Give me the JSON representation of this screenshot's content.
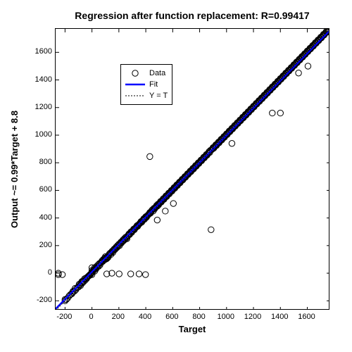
{
  "chart_data": {
    "type": "scatter",
    "title": "Regression after function replacement: R=0.99417",
    "xlabel": "Target",
    "ylabel": "Output ~= 0.99*Target + 8.8",
    "xlim": [
      -270,
      1770
    ],
    "ylim": [
      -270,
      1770
    ],
    "x_ticks": [
      -200,
      0,
      200,
      400,
      600,
      800,
      1000,
      1200,
      1400,
      1600
    ],
    "y_ticks": [
      -200,
      0,
      200,
      400,
      600,
      800,
      1000,
      1200,
      1400,
      1600
    ],
    "fit": {
      "slope": 0.99,
      "intercept": 8.8,
      "R": 0.99417,
      "color": "#0000ff"
    },
    "reference": {
      "label": "Y = T",
      "slope": 1,
      "intercept": 0
    },
    "legend": {
      "entries": [
        {
          "key": "data",
          "label": "Data"
        },
        {
          "key": "fit",
          "label": "Fit"
        },
        {
          "key": "yeq",
          "label": "Y = T"
        }
      ]
    },
    "data_points": [
      [
        -250,
        -10
      ],
      [
        -250,
        0
      ],
      [
        -220,
        -10
      ],
      [
        -200,
        -200
      ],
      [
        -200,
        -190
      ],
      [
        -190,
        -190
      ],
      [
        -180,
        -180
      ],
      [
        -170,
        -165
      ],
      [
        -160,
        -155
      ],
      [
        -150,
        -150
      ],
      [
        -145,
        -140
      ],
      [
        -140,
        -130
      ],
      [
        -130,
        -130
      ],
      [
        -125,
        -110
      ],
      [
        -120,
        -120
      ],
      [
        -110,
        -105
      ],
      [
        -100,
        -100
      ],
      [
        -95,
        -80
      ],
      [
        -90,
        -85
      ],
      [
        -85,
        -90
      ],
      [
        -80,
        -70
      ],
      [
        -75,
        -60
      ],
      [
        -70,
        -70
      ],
      [
        -65,
        -55
      ],
      [
        -60,
        -60
      ],
      [
        -55,
        -40
      ],
      [
        -50,
        -50
      ],
      [
        -45,
        -35
      ],
      [
        -40,
        -40
      ],
      [
        -35,
        -30
      ],
      [
        -30,
        -25
      ],
      [
        -25,
        -20
      ],
      [
        -20,
        -18
      ],
      [
        -15,
        -10
      ],
      [
        -10,
        -8
      ],
      [
        -5,
        0
      ],
      [
        0,
        -10
      ],
      [
        0,
        5
      ],
      [
        0,
        20
      ],
      [
        0,
        40
      ],
      [
        5,
        10
      ],
      [
        10,
        20
      ],
      [
        15,
        25
      ],
      [
        20,
        15
      ],
      [
        20,
        40
      ],
      [
        25,
        35
      ],
      [
        30,
        30
      ],
      [
        35,
        50
      ],
      [
        40,
        45
      ],
      [
        45,
        60
      ],
      [
        50,
        50
      ],
      [
        55,
        70
      ],
      [
        60,
        60
      ],
      [
        65,
        75
      ],
      [
        70,
        80
      ],
      [
        75,
        90
      ],
      [
        80,
        85
      ],
      [
        85,
        100
      ],
      [
        90,
        95
      ],
      [
        95,
        110
      ],
      [
        100,
        100
      ],
      [
        100,
        120
      ],
      [
        105,
        110
      ],
      [
        110,
        105
      ],
      [
        110,
        -5
      ],
      [
        115,
        120
      ],
      [
        120,
        115
      ],
      [
        125,
        130
      ],
      [
        130,
        140
      ],
      [
        135,
        145
      ],
      [
        140,
        135
      ],
      [
        145,
        150
      ],
      [
        148,
        0
      ],
      [
        150,
        160
      ],
      [
        155,
        150
      ],
      [
        160,
        165
      ],
      [
        165,
        175
      ],
      [
        170,
        170
      ],
      [
        175,
        180
      ],
      [
        180,
        190
      ],
      [
        185,
        185
      ],
      [
        190,
        200
      ],
      [
        195,
        195
      ],
      [
        200,
        210
      ],
      [
        202,
        -5
      ],
      [
        205,
        200
      ],
      [
        210,
        215
      ],
      [
        215,
        225
      ],
      [
        220,
        220
      ],
      [
        225,
        230
      ],
      [
        230,
        240
      ],
      [
        235,
        235
      ],
      [
        240,
        250
      ],
      [
        245,
        245
      ],
      [
        250,
        260
      ],
      [
        255,
        255
      ],
      [
        260,
        250
      ],
      [
        265,
        270
      ],
      [
        270,
        275
      ],
      [
        275,
        285
      ],
      [
        280,
        280
      ],
      [
        285,
        290
      ],
      [
        288,
        -5
      ],
      [
        290,
        300
      ],
      [
        295,
        295
      ],
      [
        300,
        305
      ],
      [
        305,
        310
      ],
      [
        310,
        320
      ],
      [
        315,
        315
      ],
      [
        320,
        325
      ],
      [
        325,
        330
      ],
      [
        330,
        335
      ],
      [
        335,
        345
      ],
      [
        340,
        340
      ],
      [
        345,
        350
      ],
      [
        350,
        355
      ],
      [
        350,
        -5
      ],
      [
        355,
        360
      ],
      [
        360,
        365
      ],
      [
        365,
        375
      ],
      [
        370,
        370
      ],
      [
        375,
        380
      ],
      [
        380,
        385
      ],
      [
        385,
        395
      ],
      [
        390,
        390
      ],
      [
        395,
        400
      ],
      [
        398,
        -10
      ],
      [
        400,
        410
      ],
      [
        405,
        405
      ],
      [
        410,
        415
      ],
      [
        415,
        420
      ],
      [
        420,
        425
      ],
      [
        425,
        430
      ],
      [
        430,
        845
      ],
      [
        430,
        440
      ],
      [
        435,
        435
      ],
      [
        440,
        445
      ],
      [
        445,
        455
      ],
      [
        450,
        460
      ],
      [
        455,
        450
      ],
      [
        460,
        470
      ],
      [
        465,
        465
      ],
      [
        470,
        475
      ],
      [
        475,
        480
      ],
      [
        480,
        490
      ],
      [
        485,
        385
      ],
      [
        485,
        485
      ],
      [
        490,
        500
      ],
      [
        495,
        495
      ],
      [
        500,
        505
      ],
      [
        505,
        510
      ],
      [
        510,
        520
      ],
      [
        515,
        515
      ],
      [
        520,
        525
      ],
      [
        525,
        530
      ],
      [
        530,
        540
      ],
      [
        535,
        535
      ],
      [
        540,
        545
      ],
      [
        545,
        450
      ],
      [
        545,
        550
      ],
      [
        550,
        560
      ],
      [
        555,
        555
      ],
      [
        560,
        565
      ],
      [
        565,
        570
      ],
      [
        570,
        580
      ],
      [
        575,
        575
      ],
      [
        580,
        585
      ],
      [
        585,
        590
      ],
      [
        590,
        600
      ],
      [
        595,
        595
      ],
      [
        600,
        605
      ],
      [
        605,
        505
      ],
      [
        605,
        610
      ],
      [
        610,
        620
      ],
      [
        615,
        615
      ],
      [
        620,
        625
      ],
      [
        625,
        630
      ],
      [
        630,
        640
      ],
      [
        635,
        635
      ],
      [
        640,
        645
      ],
      [
        645,
        650
      ],
      [
        650,
        660
      ],
      [
        655,
        655
      ],
      [
        660,
        665
      ],
      [
        665,
        670
      ],
      [
        670,
        680
      ],
      [
        675,
        675
      ],
      [
        680,
        685
      ],
      [
        685,
        690
      ],
      [
        690,
        700
      ],
      [
        695,
        695
      ],
      [
        700,
        705
      ],
      [
        705,
        710
      ],
      [
        710,
        720
      ],
      [
        715,
        715
      ],
      [
        720,
        725
      ],
      [
        725,
        730
      ],
      [
        730,
        740
      ],
      [
        735,
        735
      ],
      [
        740,
        745
      ],
      [
        745,
        750
      ],
      [
        750,
        760
      ],
      [
        755,
        755
      ],
      [
        760,
        765
      ],
      [
        765,
        770
      ],
      [
        770,
        780
      ],
      [
        775,
        775
      ],
      [
        780,
        785
      ],
      [
        785,
        790
      ],
      [
        790,
        800
      ],
      [
        795,
        795
      ],
      [
        800,
        805
      ],
      [
        805,
        810
      ],
      [
        810,
        820
      ],
      [
        815,
        815
      ],
      [
        820,
        825
      ],
      [
        825,
        830
      ],
      [
        830,
        840
      ],
      [
        835,
        835
      ],
      [
        840,
        845
      ],
      [
        845,
        850
      ],
      [
        850,
        860
      ],
      [
        855,
        855
      ],
      [
        860,
        865
      ],
      [
        865,
        870
      ],
      [
        870,
        880
      ],
      [
        875,
        875
      ],
      [
        880,
        890
      ],
      [
        885,
        315
      ],
      [
        890,
        895
      ],
      [
        895,
        900
      ],
      [
        900,
        910
      ],
      [
        905,
        905
      ],
      [
        910,
        915
      ],
      [
        915,
        920
      ],
      [
        920,
        930
      ],
      [
        925,
        925
      ],
      [
        930,
        935
      ],
      [
        935,
        940
      ],
      [
        940,
        950
      ],
      [
        945,
        945
      ],
      [
        950,
        955
      ],
      [
        955,
        960
      ],
      [
        960,
        970
      ],
      [
        965,
        965
      ],
      [
        970,
        975
      ],
      [
        975,
        980
      ],
      [
        980,
        990
      ],
      [
        985,
        985
      ],
      [
        990,
        995
      ],
      [
        995,
        1000
      ],
      [
        1000,
        1010
      ],
      [
        1005,
        1005
      ],
      [
        1010,
        1015
      ],
      [
        1015,
        1020
      ],
      [
        1020,
        1030
      ],
      [
        1025,
        1025
      ],
      [
        1030,
        1035
      ],
      [
        1035,
        1040
      ],
      [
        1040,
        940
      ],
      [
        1040,
        1050
      ],
      [
        1045,
        1045
      ],
      [
        1050,
        1055
      ],
      [
        1055,
        1060
      ],
      [
        1060,
        1070
      ],
      [
        1065,
        1065
      ],
      [
        1070,
        1075
      ],
      [
        1075,
        1080
      ],
      [
        1080,
        1090
      ],
      [
        1085,
        1085
      ],
      [
        1090,
        1095
      ],
      [
        1095,
        1100
      ],
      [
        1100,
        1110
      ],
      [
        1105,
        1105
      ],
      [
        1110,
        1115
      ],
      [
        1115,
        1120
      ],
      [
        1120,
        1130
      ],
      [
        1125,
        1125
      ],
      [
        1130,
        1135
      ],
      [
        1135,
        1140
      ],
      [
        1140,
        1150
      ],
      [
        1145,
        1145
      ],
      [
        1150,
        1155
      ],
      [
        1155,
        1160
      ],
      [
        1160,
        1170
      ],
      [
        1165,
        1165
      ],
      [
        1170,
        1175
      ],
      [
        1175,
        1180
      ],
      [
        1180,
        1190
      ],
      [
        1185,
        1185
      ],
      [
        1190,
        1195
      ],
      [
        1195,
        1200
      ],
      [
        1200,
        1210
      ],
      [
        1205,
        1205
      ],
      [
        1210,
        1215
      ],
      [
        1215,
        1220
      ],
      [
        1220,
        1230
      ],
      [
        1225,
        1225
      ],
      [
        1230,
        1235
      ],
      [
        1235,
        1240
      ],
      [
        1240,
        1250
      ],
      [
        1245,
        1245
      ],
      [
        1250,
        1255
      ],
      [
        1255,
        1260
      ],
      [
        1260,
        1270
      ],
      [
        1265,
        1265
      ],
      [
        1270,
        1275
      ],
      [
        1275,
        1280
      ],
      [
        1280,
        1290
      ],
      [
        1285,
        1285
      ],
      [
        1290,
        1295
      ],
      [
        1295,
        1300
      ],
      [
        1300,
        1310
      ],
      [
        1305,
        1305
      ],
      [
        1310,
        1315
      ],
      [
        1315,
        1320
      ],
      [
        1320,
        1330
      ],
      [
        1325,
        1325
      ],
      [
        1330,
        1335
      ],
      [
        1335,
        1340
      ],
      [
        1340,
        1160
      ],
      [
        1340,
        1350
      ],
      [
        1345,
        1345
      ],
      [
        1350,
        1355
      ],
      [
        1355,
        1360
      ],
      [
        1360,
        1370
      ],
      [
        1365,
        1365
      ],
      [
        1370,
        1375
      ],
      [
        1375,
        1380
      ],
      [
        1380,
        1390
      ],
      [
        1385,
        1385
      ],
      [
        1390,
        1395
      ],
      [
        1395,
        1400
      ],
      [
        1400,
        1160
      ],
      [
        1400,
        1410
      ],
      [
        1405,
        1405
      ],
      [
        1410,
        1415
      ],
      [
        1415,
        1420
      ],
      [
        1420,
        1430
      ],
      [
        1425,
        1425
      ],
      [
        1430,
        1435
      ],
      [
        1435,
        1440
      ],
      [
        1440,
        1450
      ],
      [
        1445,
        1445
      ],
      [
        1450,
        1455
      ],
      [
        1455,
        1460
      ],
      [
        1460,
        1470
      ],
      [
        1465,
        1465
      ],
      [
        1470,
        1475
      ],
      [
        1475,
        1480
      ],
      [
        1480,
        1490
      ],
      [
        1485,
        1485
      ],
      [
        1490,
        1495
      ],
      [
        1495,
        1500
      ],
      [
        1500,
        1510
      ],
      [
        1505,
        1505
      ],
      [
        1510,
        1515
      ],
      [
        1515,
        1520
      ],
      [
        1520,
        1530
      ],
      [
        1525,
        1525
      ],
      [
        1530,
        1535
      ],
      [
        1535,
        1450
      ],
      [
        1535,
        1540
      ],
      [
        1540,
        1550
      ],
      [
        1545,
        1545
      ],
      [
        1550,
        1555
      ],
      [
        1555,
        1560
      ],
      [
        1560,
        1570
      ],
      [
        1565,
        1565
      ],
      [
        1570,
        1575
      ],
      [
        1575,
        1580
      ],
      [
        1580,
        1590
      ],
      [
        1585,
        1585
      ],
      [
        1590,
        1595
      ],
      [
        1595,
        1600
      ],
      [
        1600,
        1610
      ],
      [
        1605,
        1500
      ],
      [
        1605,
        1605
      ],
      [
        1610,
        1615
      ],
      [
        1615,
        1620
      ],
      [
        1620,
        1630
      ],
      [
        1625,
        1625
      ],
      [
        1630,
        1635
      ],
      [
        1635,
        1640
      ],
      [
        1640,
        1650
      ],
      [
        1645,
        1645
      ],
      [
        1650,
        1655
      ],
      [
        1655,
        1660
      ],
      [
        1660,
        1670
      ],
      [
        1665,
        1665
      ],
      [
        1670,
        1675
      ],
      [
        1675,
        1680
      ],
      [
        1680,
        1690
      ],
      [
        1685,
        1685
      ],
      [
        1690,
        1695
      ],
      [
        1695,
        1700
      ],
      [
        1700,
        1710
      ],
      [
        1705,
        1705
      ],
      [
        1710,
        1715
      ],
      [
        1715,
        1720
      ],
      [
        1720,
        1730
      ],
      [
        1725,
        1725
      ],
      [
        1730,
        1735
      ],
      [
        1735,
        1740
      ],
      [
        1740,
        1750
      ],
      [
        1745,
        1745
      ],
      [
        1750,
        1750
      ],
      [
        1755,
        1760
      ],
      [
        1760,
        1760
      ]
    ]
  }
}
